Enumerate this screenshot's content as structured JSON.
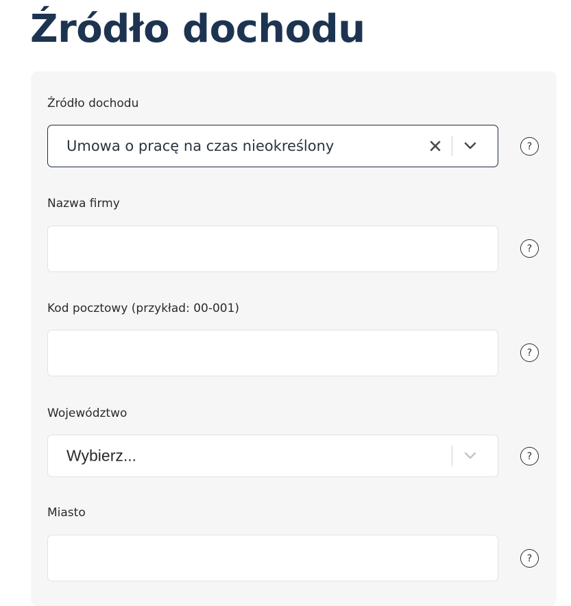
{
  "page": {
    "title": "Źródło dochodu"
  },
  "form": {
    "income_source": {
      "label": "Źródło dochodu",
      "value": "Umowa o pracę na czas nieokreślony",
      "help": "?"
    },
    "company_name": {
      "label": "Nazwa firmy",
      "value": "",
      "help": "?"
    },
    "postal_code": {
      "label": "Kod pocztowy (przykład: 00-001)",
      "value": "",
      "help": "?"
    },
    "voivodeship": {
      "label": "Województwo",
      "placeholder": "Wybierz...",
      "help": "?"
    },
    "city": {
      "label": "Miasto",
      "value": "",
      "help": "?"
    }
  },
  "icons": {
    "clear": "close-icon",
    "dropdown": "chevron-down-icon",
    "help": "question-circle-icon"
  },
  "colors": {
    "title": "#1d3451",
    "panel_background": "#f6f6f6",
    "active_border": "#1d2b3d"
  }
}
